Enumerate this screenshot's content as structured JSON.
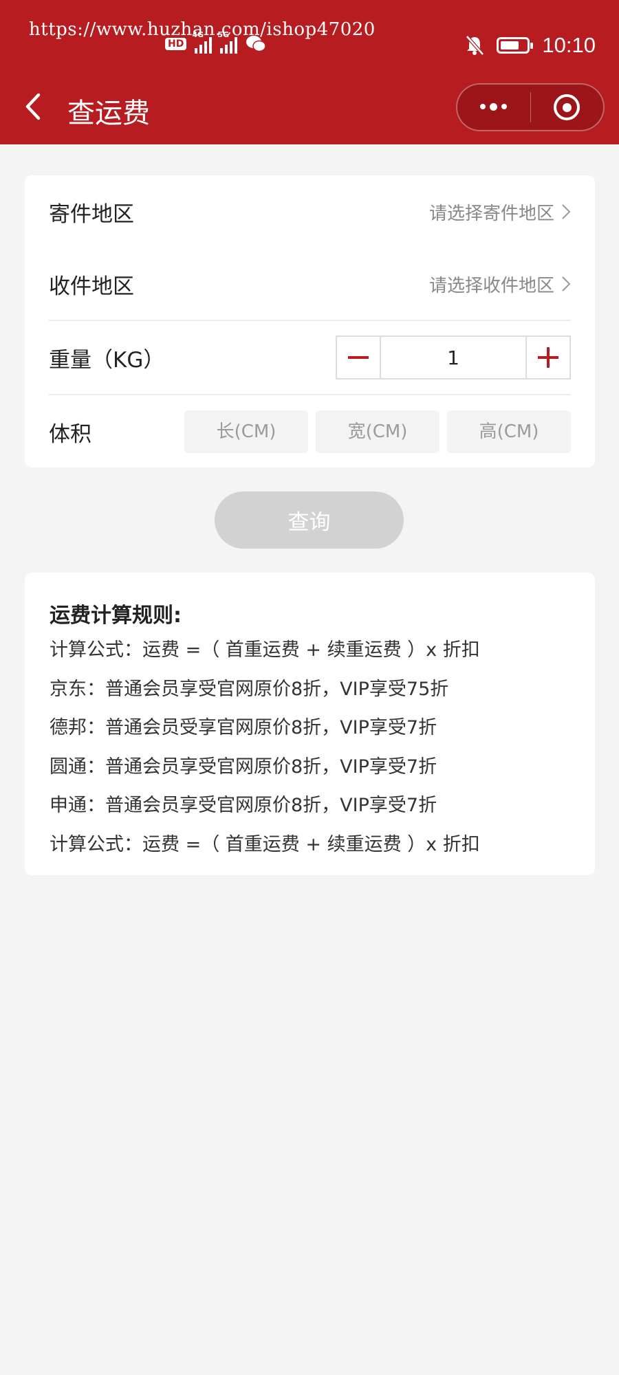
{
  "status_bar": {
    "watermark": "https://www.huzhan.com/ishop47020",
    "hd_badge": "HD",
    "sim1_tag": "4G",
    "sim2_tag": "5G",
    "time": "10:10"
  },
  "nav": {
    "title": "查运费",
    "icons": [
      "back-icon",
      "more-dots-icon",
      "target-icon"
    ]
  },
  "form": {
    "sender_region": {
      "label": "寄件地区",
      "placeholder": "请选择寄件地区"
    },
    "receiver_region": {
      "label": "收件地区",
      "placeholder": "请选择收件地区"
    },
    "weight": {
      "label": "重量（KG）",
      "value": "1"
    },
    "volume": {
      "label": "体积",
      "length_placeholder": "长(CM)",
      "width_placeholder": "宽(CM)",
      "height_placeholder": "高(CM)"
    }
  },
  "query_button": "查询",
  "rules": {
    "title": "运费计算规则:",
    "lines": [
      "计算公式：运费 =（ 首重运费 + 续重运费 ）x 折扣",
      "京东：普通会员享受官网原价8折，VIP享受75折",
      "德邦：普通会员受享官网原价8折，VIP享受7折",
      "圆通：普通会员享受官网原价8折，VIP享受7折",
      "申通：普通会员享受官网原价8折，VIP享受7折",
      "计算公式：运费 =（ 首重运费 + 续重运费 ）x 折扣"
    ]
  },
  "colors": {
    "brand_red": "#b71d20",
    "background": "#f4f4f4",
    "button_disabled": "#d2d2d2"
  }
}
